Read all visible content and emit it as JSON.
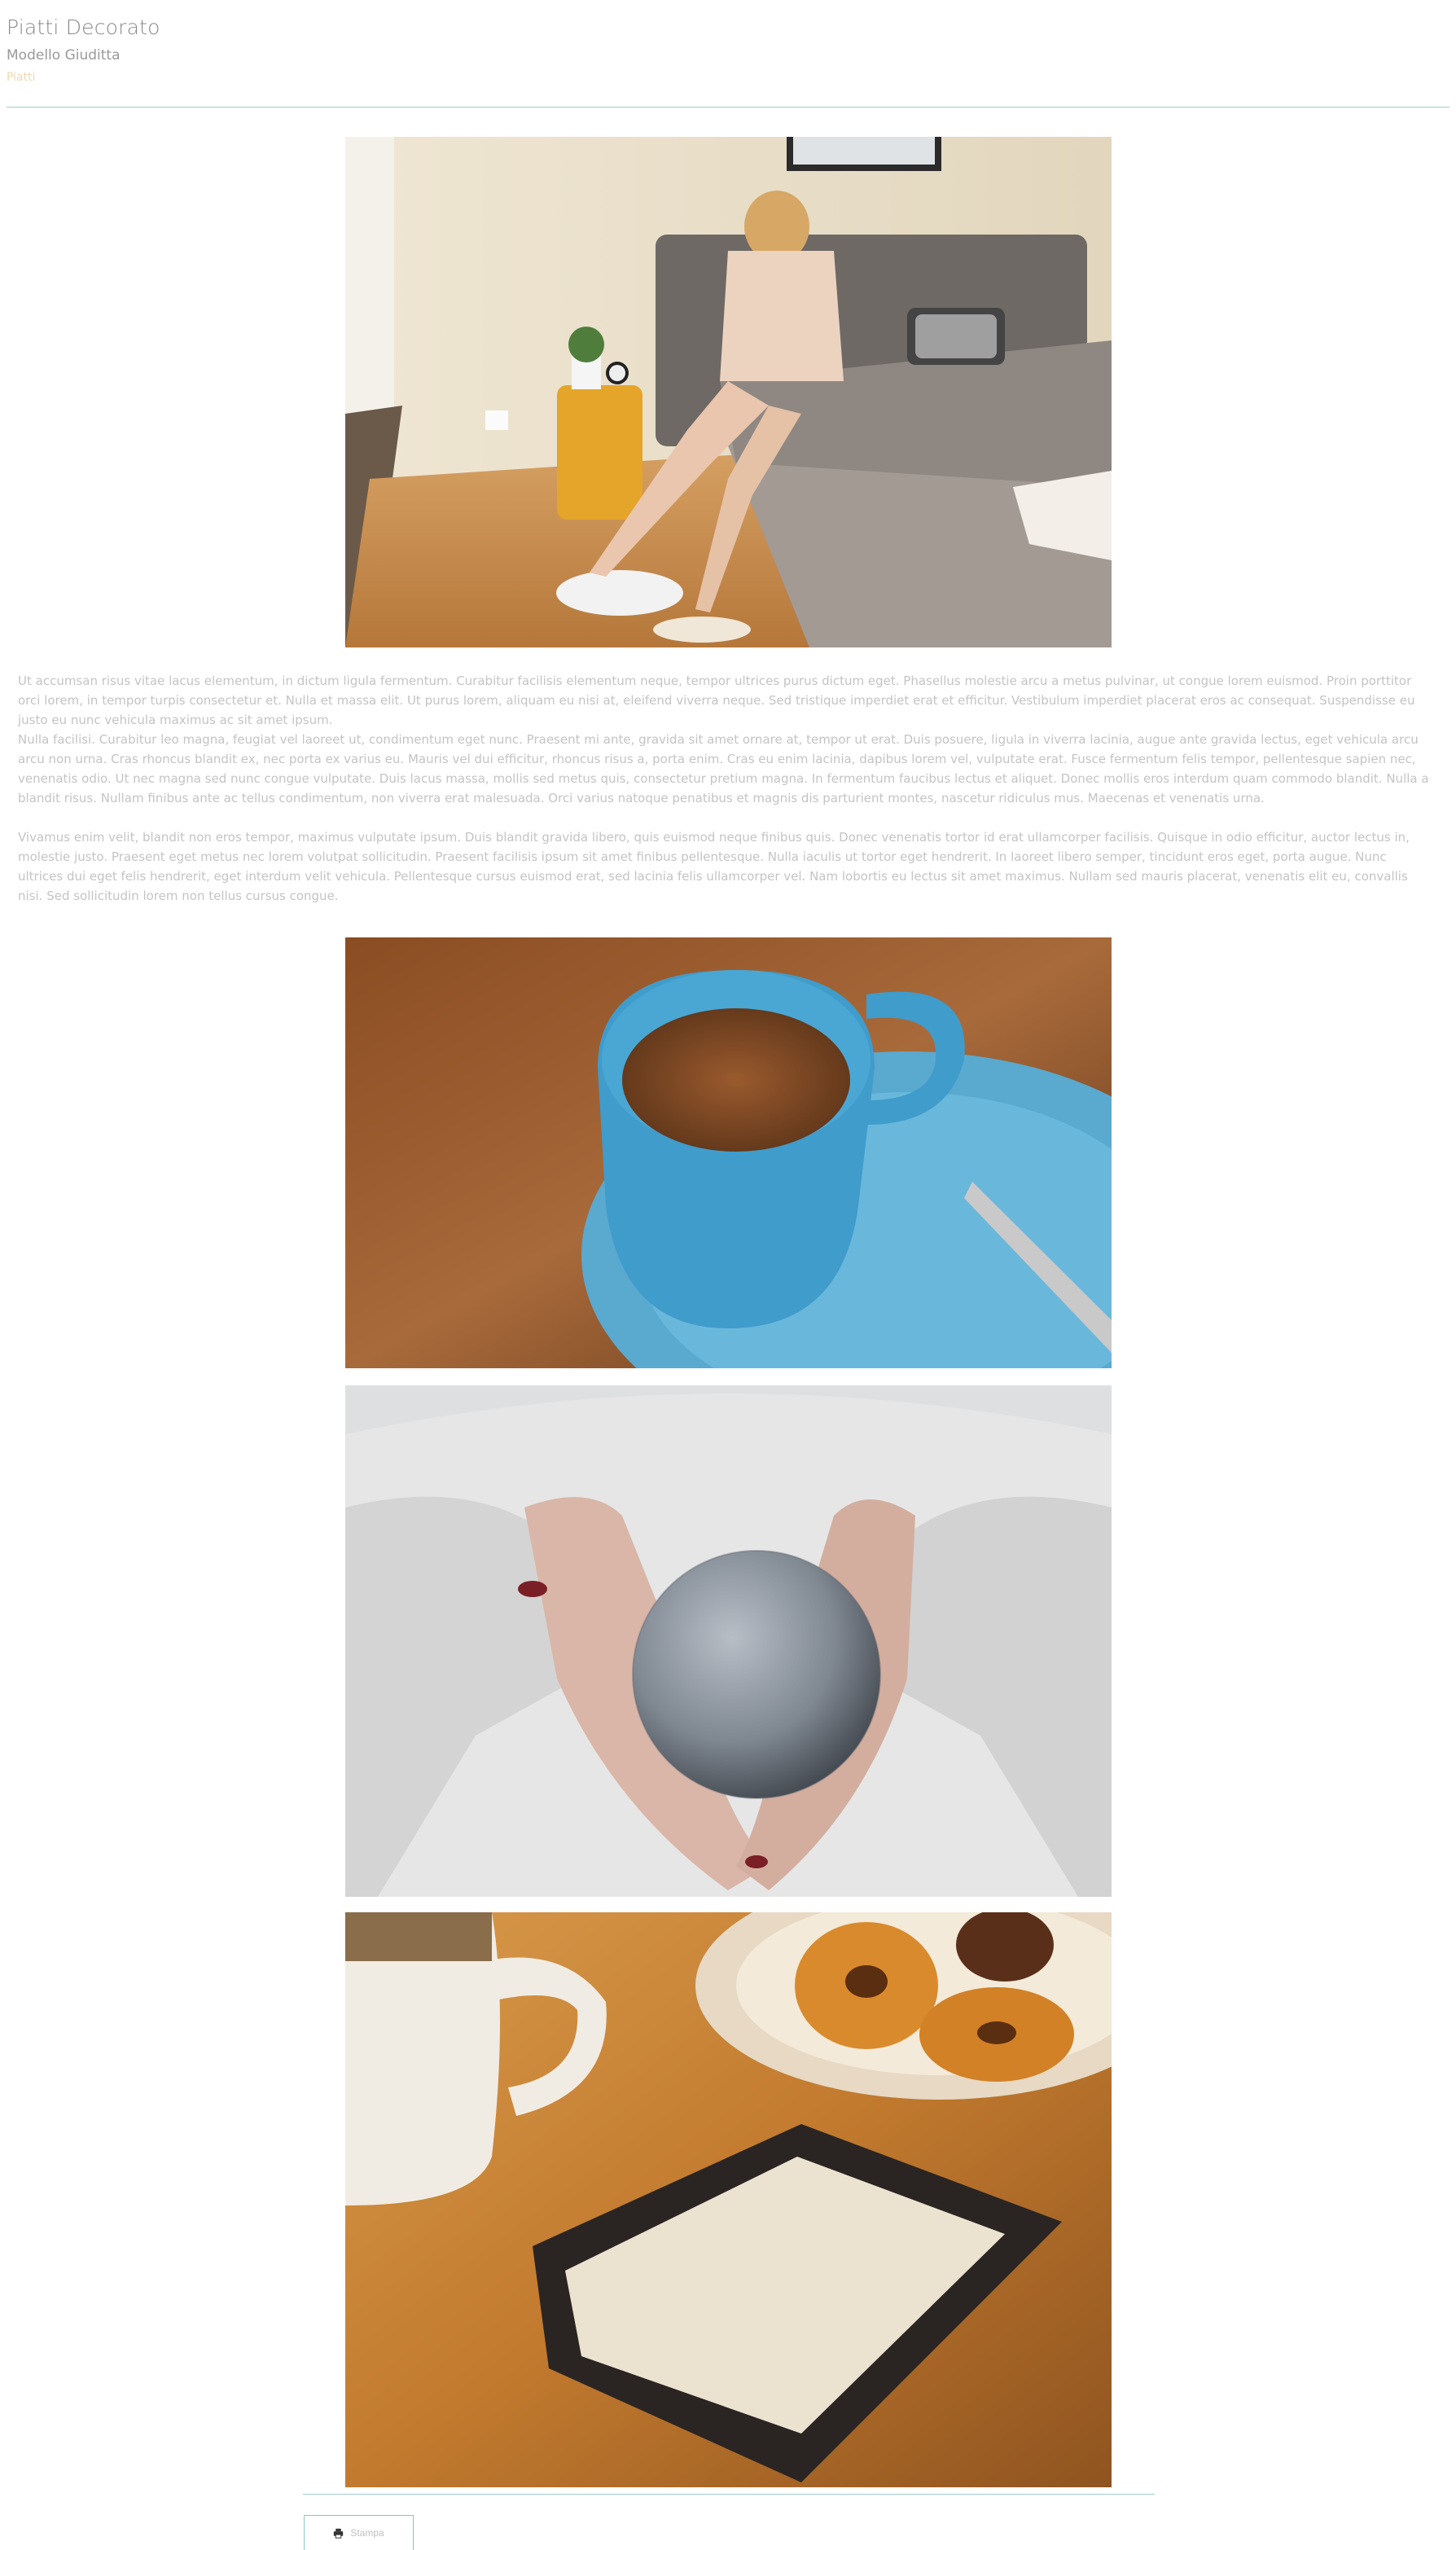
{
  "page": {
    "title": "Piatti Decorato",
    "subtitle": "Modello Giuditta",
    "category": "Piatti"
  },
  "content": {
    "paragraphs": [
      "Ut accumsan risus vitae lacus elementum, in dictum ligula fermentum. Curabitur facilisis elementum neque, tempor ultrices purus dictum eget. Phasellus molestie arcu a metus pulvinar, ut congue lorem euismod. Proin porttitor orci lorem, in tempor turpis consectetur et. Nulla et massa elit. Ut purus lorem, aliquam eu nisi at, eleifend viverra neque. Sed tristique imperdiet erat et efficitur. Vestibulum imperdiet placerat eros ac consequat. Suspendisse eu justo eu nunc vehicula maximus ac sit amet ipsum.",
      "Nulla facilisi. Curabitur leo magna, feugiat vel laoreet ut, condimentum eget nunc. Praesent mi ante, gravida sit amet ornare at, tempor ut erat. Duis posuere, ligula in viverra lacinia, augue ante gravida lectus, eget vehicula arcu arcu non urna. Cras rhoncus blandit ex, nec porta ex varius eu. Mauris vel dui efficitur, rhoncus risus a, porta enim. Cras eu enim lacinia, dapibus lorem vel, vulputate erat. Fusce fermentum felis tempor, pellentesque sapien nec, venenatis odio. Ut nec magna sed nunc congue vulputate. Duis lacus massa, mollis sed metus quis, consectetur pretium magna. In fermentum faucibus lectus et aliquet. Donec mollis eros interdum quam commodo blandit. Nulla a blandit risus. Nullam finibus ante ac tellus condimentum, non viverra erat malesuada. Orci varius natoque penatibus et magnis dis parturient montes, nascetur ridiculus mus. Maecenas et venenatis urna.",
      "Vivamus enim velit, blandit non eros tempor, maximus vulputate ipsum. Duis blandit gravida libero, quis euismod neque finibus quis. Donec venenatis tortor id erat ullamcorper facilisis. Quisque in odio efficitur, auctor lectus in, molestie justo. Praesent eget metus nec lorem volutpat sollicitudin. Praesent facilisis ipsum sit amet finibus pellentesque. Nulla iaculis ut tortor eget hendrerit. In laoreet libero semper, tincidunt eros eget, porta augue. Nunc ultrices dui eget felis hendrerit, eget interdum velit vehicula. Pellentesque cursus euismod erat, sed lacinia felis ullamcorper vel. Nam lobortis eu lectus sit amet maximus. Nullam sed mauris placerat, venenatis elit eu, convallis nisi. Sed sollicitudin lorem non tellus cursus congue."
    ]
  },
  "images": {
    "main": "bedroom-photo",
    "gallery": [
      "coffee-cup-photo",
      "ornament-ball-photo",
      "ereader-donuts-photo"
    ]
  },
  "actions": {
    "print_label": "Stampa",
    "print_icon": "printer-icon"
  },
  "colors": {
    "divider": "#9fcfcf",
    "category": "#f1d7b4",
    "button_border": "#8cc5c5"
  }
}
